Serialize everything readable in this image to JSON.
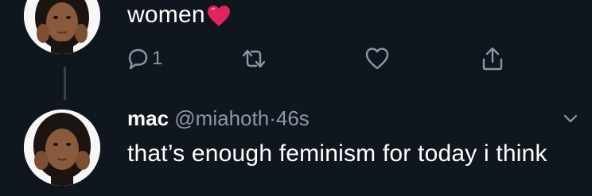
{
  "tweet_top": {
    "text": "women",
    "reply_count": "1",
    "emoji": "heart-emoji"
  },
  "actions": {
    "reply_icon": "reply-icon",
    "retweet_icon": "retweet-icon",
    "like_icon": "like-icon",
    "share_icon": "share-icon"
  },
  "tweet_reply": {
    "name": "mac",
    "handle": "@miahoth",
    "separator": "·",
    "time": "46s",
    "text": "that’s enough feminism for today i think"
  },
  "colors": {
    "background": "#0f161d",
    "text": "#ffffff",
    "secondary": "#8899a6",
    "heart": "#e0245e",
    "thread_line": "#38444d"
  }
}
